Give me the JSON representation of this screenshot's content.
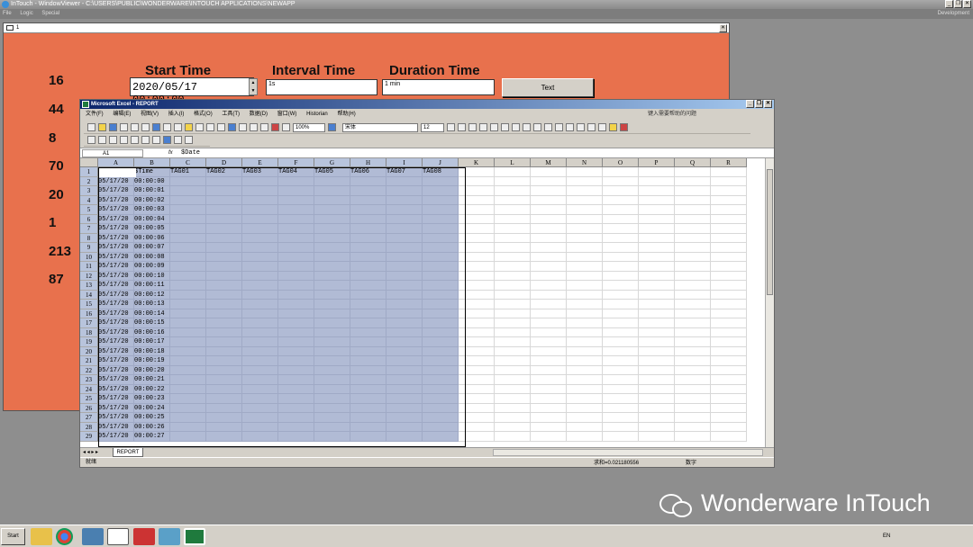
{
  "windowviewer": {
    "title": "InTouch - WindowViewer - C:\\USERS\\PUBLIC\\WONDERWARE\\INTOUCH APPLICATIONS\\NEWAPP",
    "menu": [
      "File",
      "Logic",
      "Special"
    ],
    "mode": "Development",
    "controls": [
      "_",
      "❐",
      "✕"
    ]
  },
  "intouch_window": {
    "title": "1",
    "close": "✕",
    "numbers": [
      "16",
      "44",
      "8",
      "70",
      "20",
      "1",
      "213",
      "87"
    ],
    "start_label": "Start Time",
    "interval_label": "Interval Time",
    "duration_label": "Duration Time",
    "start_value": "2020/05/17 00:00:00",
    "interval_value": "1s",
    "duration_value": "1 min",
    "text_button": "Text"
  },
  "excel": {
    "title": "Microsoft Excel - REPORT",
    "menu": [
      "文件(F)",
      "编辑(E)",
      "视图(V)",
      "插入(I)",
      "格式(O)",
      "工具(T)",
      "数据(D)",
      "窗口(W)",
      "Historian",
      "帮助(H)"
    ],
    "help_placeholder": "键入需要帮助的问题",
    "zoom": "100%",
    "font": "宋体",
    "font_size": "12",
    "name_box": "A1",
    "fx": "fx",
    "formula": "$Date",
    "columns": [
      "A",
      "B",
      "C",
      "D",
      "E",
      "F",
      "G",
      "H",
      "I",
      "J",
      "K",
      "L",
      "M",
      "N",
      "O",
      "P",
      "Q",
      "R"
    ],
    "header_row": [
      "$Date",
      "$Time",
      "TAG01",
      "TAG02",
      "TAG03",
      "TAG04",
      "TAG05",
      "TAG06",
      "TAG07",
      "TAG08"
    ],
    "date": "05/17/20",
    "times": [
      "00:00:00",
      "00:00:01",
      "00:00:02",
      "00:00:03",
      "00:00:04",
      "00:00:05",
      "00:00:06",
      "00:00:07",
      "00:00:08",
      "00:00:09",
      "00:00:10",
      "00:00:11",
      "00:00:12",
      "00:00:13",
      "00:00:14",
      "00:00:15",
      "00:00:16",
      "00:00:17",
      "00:00:18",
      "00:00:19",
      "00:00:20",
      "00:00:21",
      "00:00:22",
      "00:00:23",
      "00:00:24",
      "00:00:25",
      "00:00:26",
      "00:00:27"
    ],
    "sheet_tab": "REPORT",
    "status": "就绪",
    "sum": "求和=0.021180556",
    "numlock": "数字"
  },
  "watermark": "Wonderware InTouch",
  "taskbar": {
    "start": "Start",
    "language": "EN",
    "icons": [
      "folder-icon",
      "chrome-icon",
      "network-icon",
      "trend-icon",
      "toolbox-icon",
      "intouch-icon",
      "excel-icon"
    ]
  }
}
